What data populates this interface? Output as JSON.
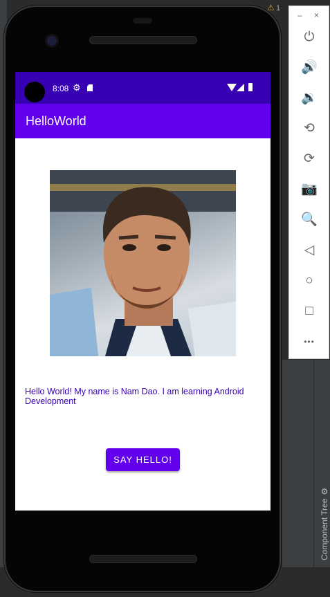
{
  "ide": {
    "warning_icon": "warning-icon",
    "warning_count": "1",
    "component_tree_label": "Component Tree"
  },
  "status_bar": {
    "time": "8:08"
  },
  "app": {
    "title": "HelloWorld"
  },
  "content": {
    "message": "Hello World! My name is Nam Dao. I am learning Android Development",
    "button_label": "SAY HELLO!"
  },
  "toolbar": {
    "buttons": [
      {
        "name": "power-icon",
        "glyph": "⏻"
      },
      {
        "name": "volume-up-icon",
        "glyph": "🔊"
      },
      {
        "name": "volume-down-icon",
        "glyph": "🔉"
      },
      {
        "name": "rotate-left-icon",
        "glyph": "⟲"
      },
      {
        "name": "rotate-right-icon",
        "glyph": "⟳"
      },
      {
        "name": "camera-icon",
        "glyph": "📷"
      },
      {
        "name": "zoom-icon",
        "glyph": "🔍"
      },
      {
        "name": "back-icon",
        "glyph": "◁"
      },
      {
        "name": "home-icon",
        "glyph": "○"
      },
      {
        "name": "overview-icon",
        "glyph": "□"
      },
      {
        "name": "more-icon",
        "glyph": "•••"
      }
    ]
  },
  "colors": {
    "primary": "#6200ee",
    "primary_dark": "#3700b3",
    "text": "#3700b3"
  }
}
